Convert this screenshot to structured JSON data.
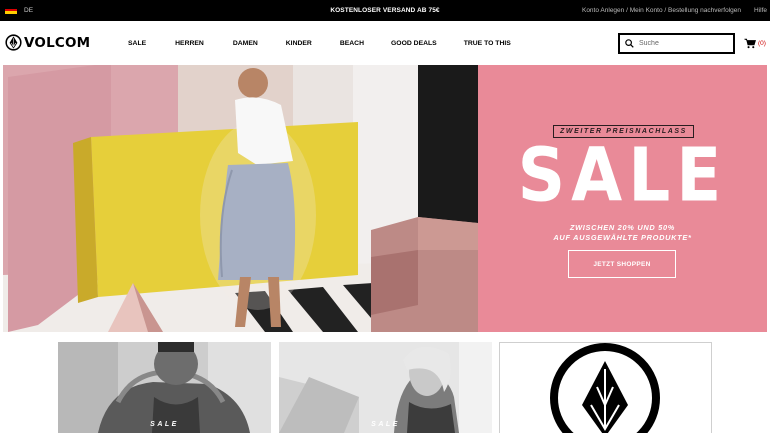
{
  "topbar": {
    "language": "DE",
    "promo": "KOSTENLOSER VERSAND AB 75€",
    "links": [
      "Konto Anlegen / Mein Konto / Bestellung nachverfolgen",
      "Hilfe"
    ]
  },
  "header": {
    "logo_text": "VOLCOM",
    "nav": [
      "SALE",
      "HERREN",
      "DAMEN",
      "KINDER",
      "BEACH",
      "GOOD DEALS",
      "TRUE TO THIS"
    ],
    "search_placeholder": "Suche",
    "cart_count": "(0)"
  },
  "hero": {
    "tag": "ZWEITER PREISNACHLASS",
    "headline": "SALE",
    "subline_1": "ZWISCHEN 20% UND 50%",
    "subline_2": "AUF AUSGEWÄHLTE PRODUKTE*",
    "cta": "JETZT SHOPPEN"
  },
  "tiles": [
    {
      "label": "SALE"
    },
    {
      "label": "SALE"
    },
    {
      "label": ""
    }
  ],
  "colors": {
    "topbar_bg": "#000000",
    "hero_right_bg": "#e98a98",
    "cart_count": "#cc0000"
  }
}
